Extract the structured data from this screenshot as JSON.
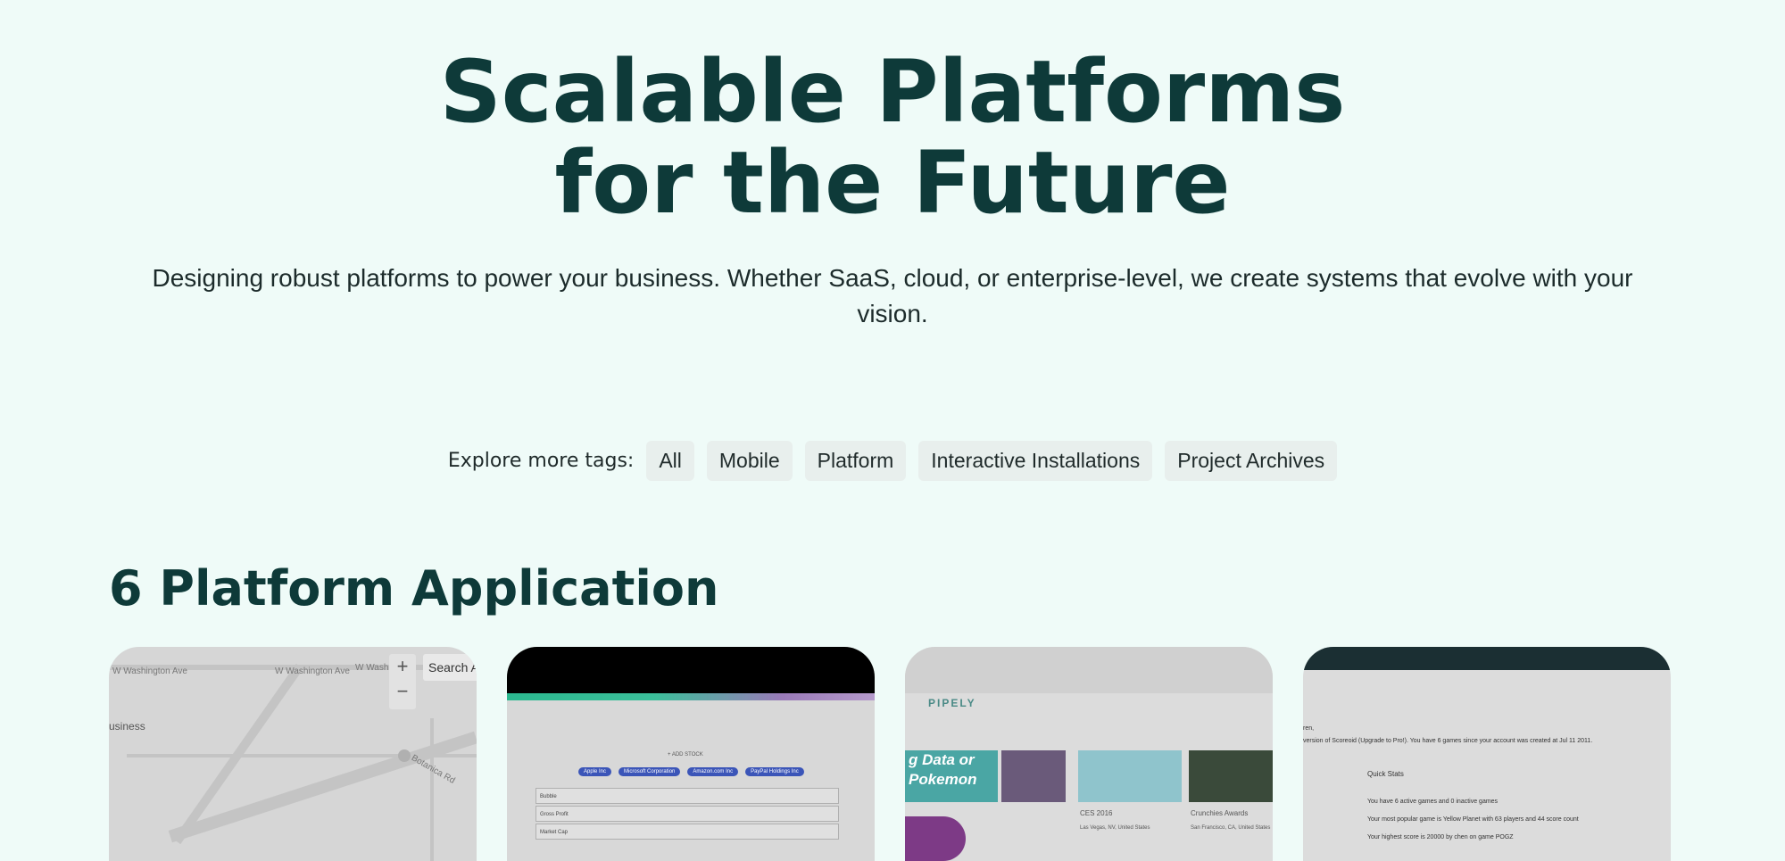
{
  "hero": {
    "title_line1": "Scalable Platforms",
    "title_line2": "for the Future",
    "subtitle": "Designing robust platforms to power your business. Whether SaaS, cloud, or enterprise-level, we create systems that evolve with your vision."
  },
  "tags": {
    "label": "Explore more tags:",
    "items": [
      "All",
      "Mobile",
      "Platform",
      "Interactive Installations",
      "Project Archives"
    ]
  },
  "section": {
    "title": "6 Platform Application"
  },
  "cards": {
    "map": {
      "search": "Search A",
      "zoom_in": "+",
      "zoom_out": "−",
      "street1": "W Washington Ave",
      "street2": "W Washington Ave",
      "street3": "W Washin",
      "biz": "usiness",
      "street4": "Botanica Rd"
    },
    "dashboard": {
      "add": "+ ADD STOCK",
      "chips": [
        "Apple Inc",
        "Microsoft Corporation",
        "Amazon.com Inc",
        "PayPal Holdings Inc"
      ],
      "rows": [
        "Bubble",
        "Gross Profit",
        "Market Cap"
      ]
    },
    "pipely": {
      "logo": "PIPELY",
      "hero_text": "g Data or Pokemon",
      "event1": "CES 2016",
      "event1_loc": "Las Vegas, NV, United States",
      "event2": "Crunchies Awards",
      "event2_loc": "San Francisco, CA, United States"
    },
    "scoreoid": {
      "greeting": "ren,",
      "version": "version of Scoreoid (Upgrade to Pro!). You have 6 games since your account was created at Jul 11 2011.",
      "quick_stats": "Quick Stats",
      "stat1": "You have 6 active games and 0 inactive games",
      "stat2": "Your most popular game is Yellow Planet with 63 players and 44 score count",
      "stat3": "Your highest score is 20000 by chen on game POGZ"
    }
  },
  "colors": {
    "background": "#effbf8",
    "heading": "#0e3a39",
    "tag_bg": "#e8efed"
  }
}
